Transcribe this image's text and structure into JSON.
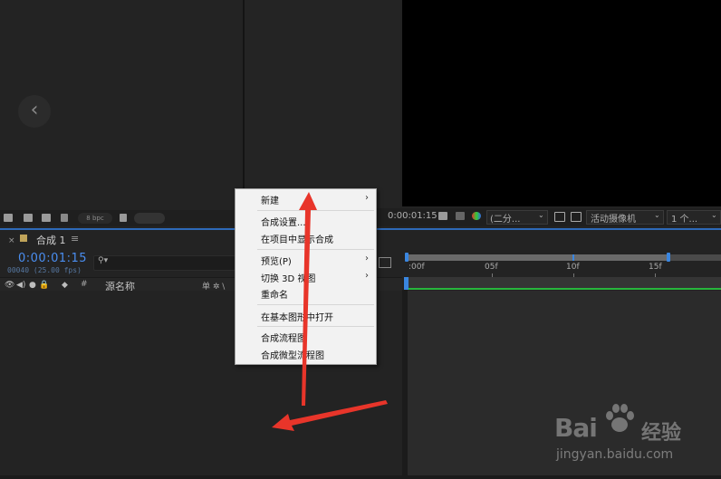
{
  "project_panel": {
    "back_icon": "chevron-left-icon",
    "back_glyph": "‹"
  },
  "toolbar_left": {
    "bpc_label": "8 bpc",
    "icons": [
      "interpret-footage-icon",
      "folder-icon",
      "composition-icon",
      "flowchart-icon",
      "tag-icon",
      "trash-icon"
    ]
  },
  "toolbar_right": {
    "timecode": "0:00:01:15",
    "resolution": "(二分...",
    "camera": "活动摄像机",
    "views": "1 个...",
    "icons": [
      "snapshot-icon",
      "show-snapshot-icon",
      "color-channels-icon",
      "region-icon",
      "transparency-grid-icon"
    ]
  },
  "timeline": {
    "close_glyph": "×",
    "comp_title": "合成 1",
    "menu_glyph": "≡",
    "timecode": "0:00:01:15",
    "fps_line": "00040 (25.00 fps)",
    "search_glyph": "⚲▾",
    "columns": {
      "num": "#",
      "source_name": "源名称",
      "switches": "单 ✲ \\"
    },
    "ruler_labels": [
      ":00f",
      "05f",
      "10f",
      "15f"
    ],
    "colors": {
      "accent": "#2d69b8",
      "timecode": "#4a8ef0",
      "work_area": "#27b63c",
      "swatch": "#c0a45a"
    }
  },
  "context_menu": {
    "items": [
      {
        "label": "新建",
        "submenu": true
      },
      {
        "label": "合成设置...",
        "submenu": false
      },
      {
        "label": "在项目中显示合成",
        "submenu": false
      },
      {
        "label": "预览(P)",
        "submenu": true
      },
      {
        "label": "切换 3D 视图",
        "submenu": true
      },
      {
        "label": "重命名",
        "submenu": false
      },
      {
        "label": "在基本图形中打开",
        "submenu": false
      },
      {
        "label": "合成流程图",
        "submenu": false
      },
      {
        "label": "合成微型流程图",
        "submenu": false
      }
    ],
    "submenu_glyph": "›"
  },
  "watermark": {
    "brand": "Bai",
    "brand_tail": "du",
    "cn": "经验",
    "url": "jingyan.baidu.com"
  },
  "annotations": {
    "arrow_color": "#e8352a"
  }
}
